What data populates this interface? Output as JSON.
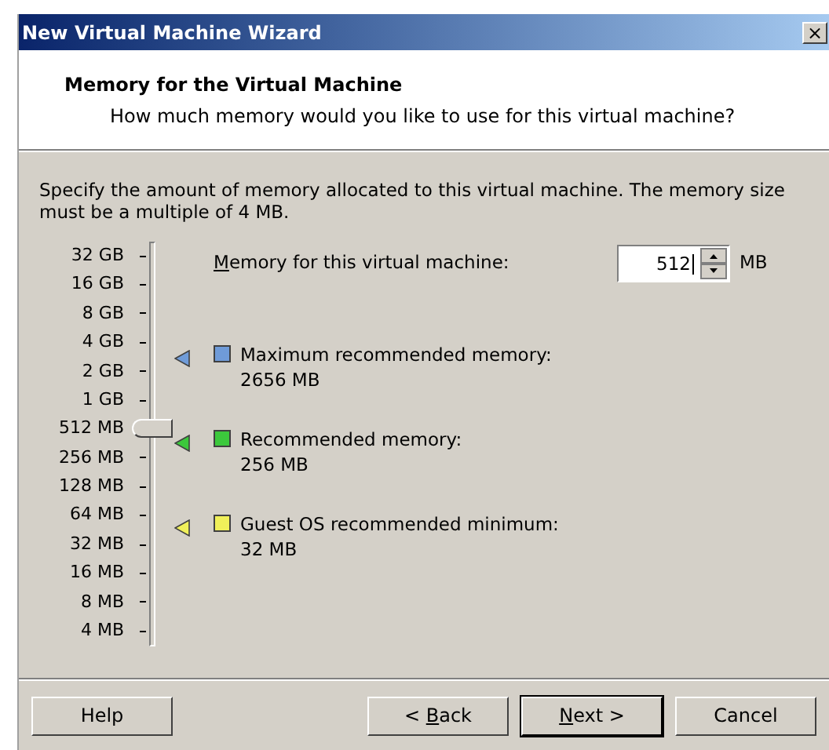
{
  "window": {
    "title": "New Virtual Machine Wizard",
    "close": "×"
  },
  "header": {
    "title": "Memory for the Virtual Machine",
    "subtitle": "How much memory would you like to use for this virtual machine?"
  },
  "description": "Specify the amount of memory allocated to this virtual machine. The memory size must be a multiple of 4 MB.",
  "slider": {
    "ticks": [
      "32 GB",
      "16 GB",
      "8 GB",
      "4 GB",
      "2 GB",
      "1 GB",
      "512 MB",
      "256 MB",
      "128 MB",
      "64 MB",
      "32 MB",
      "16 MB",
      "8 MB",
      "4 MB"
    ],
    "level": 0.538
  },
  "memory": {
    "label": "Memory for this virtual machine:",
    "accelerator": true,
    "value": "512",
    "unit": "MB"
  },
  "legend": [
    {
      "label": "Maximum recommended memory:",
      "value": "2656 MB",
      "color": "#6f9bd8"
    },
    {
      "label": "Recommended memory:",
      "value": "256 MB",
      "color": "#3cc83c"
    },
    {
      "label": "Guest OS recommended minimum:",
      "value": "32 MB",
      "color": "#f0f05a"
    }
  ],
  "buttons": [
    {
      "label": "Help",
      "accelerator": false,
      "default": false
    },
    {
      "label": "< Back",
      "accelerator": true,
      "default": false
    },
    {
      "label": "Next >",
      "accelerator": true,
      "default": true
    },
    {
      "label": "Cancel",
      "accelerator": false,
      "default": false
    }
  ]
}
